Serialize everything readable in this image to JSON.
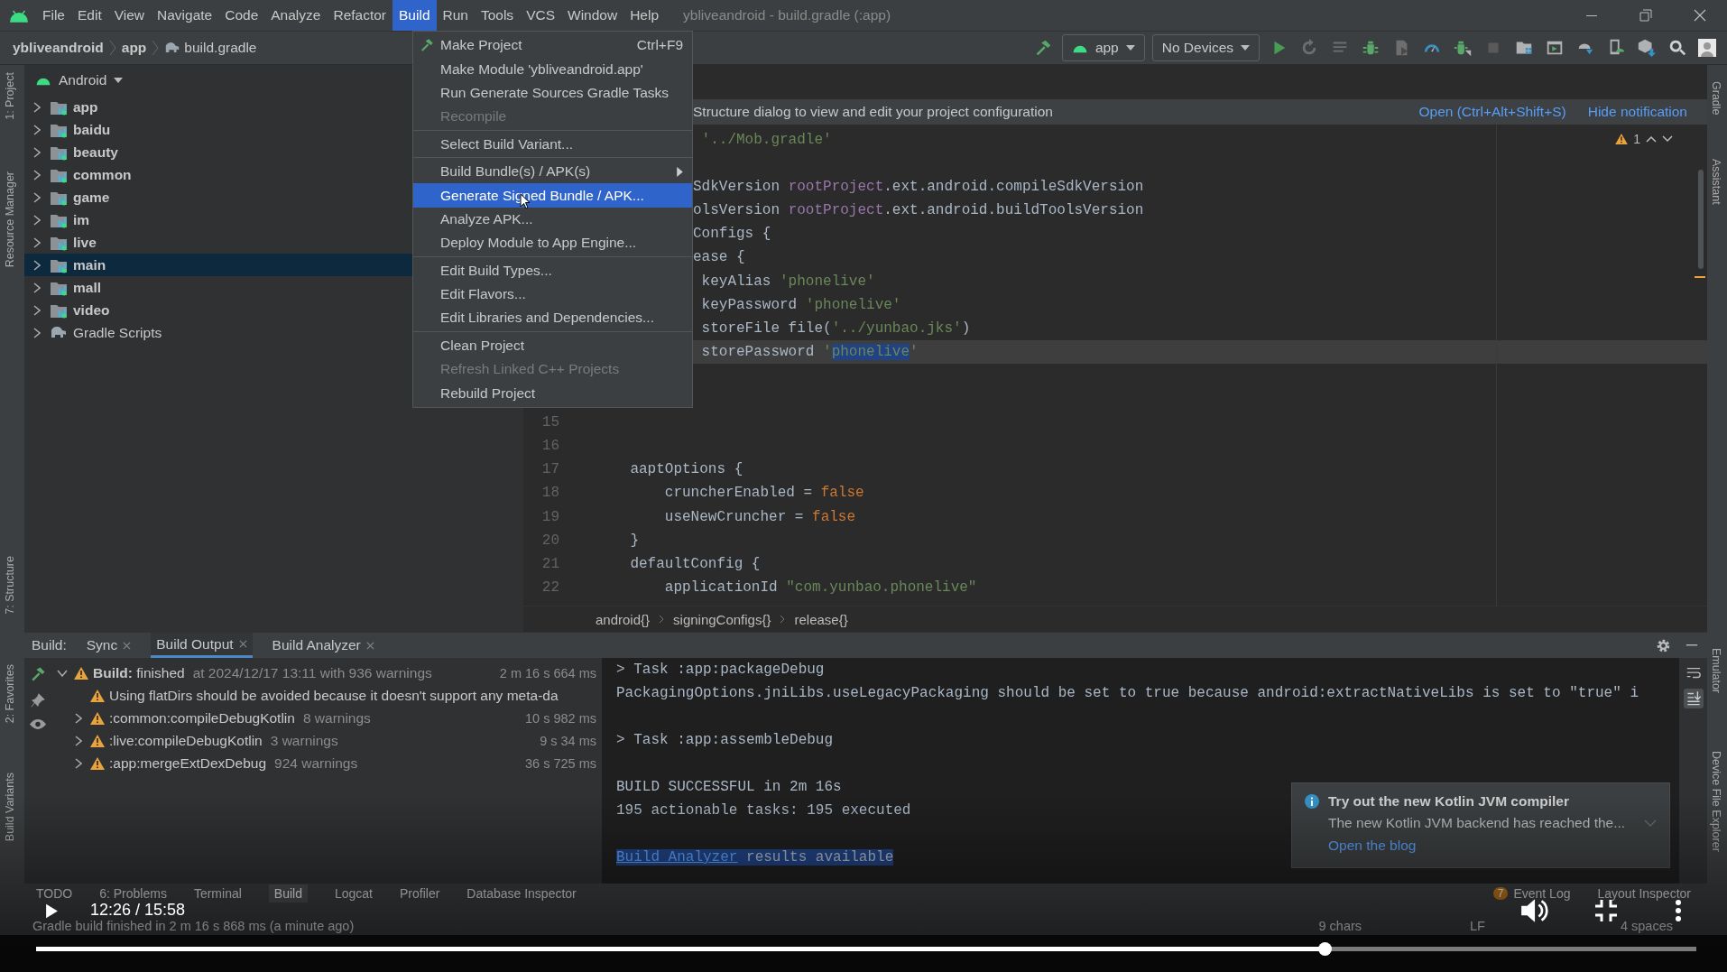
{
  "window": {
    "title": "ybliveandroid - build.gradle (:app)"
  },
  "menu_bar": [
    {
      "label": "File",
      "selected": false
    },
    {
      "label": "Edit",
      "selected": false
    },
    {
      "label": "View",
      "selected": false
    },
    {
      "label": "Navigate",
      "selected": false
    },
    {
      "label": "Code",
      "selected": false
    },
    {
      "label": "Analyze",
      "selected": false
    },
    {
      "label": "Refactor",
      "selected": false
    },
    {
      "label": "Build",
      "selected": true
    },
    {
      "label": "Run",
      "selected": false
    },
    {
      "label": "Tools",
      "selected": false
    },
    {
      "label": "VCS",
      "selected": false
    },
    {
      "label": "Window",
      "selected": false
    },
    {
      "label": "Help",
      "selected": false
    }
  ],
  "breadcrumbs": [
    "ybliveandroid",
    "app",
    "build.gradle"
  ],
  "toolbar": {
    "configuration": "app",
    "device": "No Devices"
  },
  "left_tools": [
    "1: Project",
    "Resource Manager",
    "7: Structure",
    "2: Favorites",
    "Build Variants"
  ],
  "right_tools": [
    "Gradle",
    "Assistant",
    "Emulator",
    "Device File Explorer"
  ],
  "project_panel": {
    "view": "Android",
    "items": [
      {
        "label": "app",
        "kind": "module",
        "selected": false,
        "expanded": false
      },
      {
        "label": "baidu",
        "kind": "module",
        "selected": false,
        "expanded": false
      },
      {
        "label": "beauty",
        "kind": "module",
        "selected": false,
        "expanded": false
      },
      {
        "label": "common",
        "kind": "module",
        "selected": false,
        "expanded": false
      },
      {
        "label": "game",
        "kind": "module",
        "selected": false,
        "expanded": false
      },
      {
        "label": "im",
        "kind": "module",
        "selected": false,
        "expanded": false
      },
      {
        "label": "live",
        "kind": "module",
        "selected": false,
        "expanded": false
      },
      {
        "label": "main",
        "kind": "module",
        "selected": true,
        "expanded": false
      },
      {
        "label": "mall",
        "kind": "module",
        "selected": false,
        "expanded": false
      },
      {
        "label": "video",
        "kind": "module",
        "selected": false,
        "expanded": false
      },
      {
        "label": "Gradle Scripts",
        "kind": "scripts",
        "selected": false,
        "expanded": false
      }
    ]
  },
  "build_menu": {
    "groups": [
      [
        {
          "label": "Make Project",
          "shortcut": "Ctrl+F9",
          "kind": "hammer",
          "disabled": false,
          "selected": false,
          "submenu": false
        },
        {
          "label": "Make Module 'ybliveandroid.app'",
          "disabled": false,
          "selected": false,
          "submenu": false
        },
        {
          "label": "Run Generate Sources Gradle Tasks",
          "disabled": false,
          "selected": false,
          "submenu": false
        },
        {
          "label": "Recompile",
          "disabled": true,
          "selected": false,
          "submenu": false
        }
      ],
      [
        {
          "label": "Select Build Variant...",
          "disabled": false,
          "selected": false,
          "submenu": false
        }
      ],
      [
        {
          "label": "Build Bundle(s) / APK(s)",
          "disabled": false,
          "selected": false,
          "submenu": true
        },
        {
          "label": "Generate Signed Bundle / APK...",
          "disabled": false,
          "selected": true,
          "submenu": false
        },
        {
          "label": "Analyze APK...",
          "disabled": false,
          "selected": false,
          "submenu": false
        },
        {
          "label": "Deploy Module to App Engine...",
          "disabled": false,
          "selected": false,
          "submenu": false
        }
      ],
      [
        {
          "label": "Edit Build Types...",
          "disabled": false,
          "selected": false,
          "submenu": false
        },
        {
          "label": "Edit Flavors...",
          "disabled": false,
          "selected": false,
          "submenu": false
        },
        {
          "label": "Edit Libraries and Dependencies...",
          "disabled": false,
          "selected": false,
          "submenu": false
        }
      ],
      [
        {
          "label": "Clean Project",
          "disabled": false,
          "selected": false,
          "submenu": false
        },
        {
          "label": "Refresh Linked C++ Projects",
          "disabled": true,
          "selected": false,
          "submenu": false
        },
        {
          "label": "Rebuild Project",
          "disabled": false,
          "selected": false,
          "submenu": false
        }
      ]
    ]
  },
  "notification": {
    "text": "Structure dialog to view and edit your project configuration",
    "links": [
      "Open (Ctrl+Alt+Shift+S)",
      "Hide notification"
    ]
  },
  "editor": {
    "warnings": "1",
    "lines": [
      {
        "kind": "cut",
        "current": false,
        "tokens": [
          {
            "text": " '../Mob.gradle'",
            "kind": "str"
          }
        ]
      },
      {
        "kind": "blank",
        "current": false
      },
      {
        "kind": "cut",
        "current": false,
        "tokens": [
          {
            "text": "SdkVersion ",
            "kind": "plain"
          },
          {
            "text": "rootProject",
            "kind": "ref"
          },
          {
            "text": ".ext.android.compileSdkVersion",
            "kind": "plain"
          }
        ]
      },
      {
        "kind": "cut",
        "current": false,
        "tokens": [
          {
            "text": "olsVersion ",
            "kind": "plain"
          },
          {
            "text": "rootProject",
            "kind": "ref"
          },
          {
            "text": ".ext.android.buildToolsVersion",
            "kind": "plain"
          }
        ]
      },
      {
        "kind": "cut",
        "current": false,
        "tokens": [
          {
            "text": "Configs {",
            "kind": "plain"
          }
        ]
      },
      {
        "kind": "cut",
        "current": false,
        "tokens": [
          {
            "text": "ease {",
            "kind": "plain"
          }
        ]
      },
      {
        "kind": "cut",
        "current": false,
        "tokens": [
          {
            "text": " keyAlias ",
            "kind": "plain"
          },
          {
            "text": "'phonelive'",
            "kind": "str"
          }
        ]
      },
      {
        "kind": "cut",
        "current": false,
        "tokens": [
          {
            "text": " keyPassword ",
            "kind": "plain"
          },
          {
            "text": "'phonelive'",
            "kind": "str"
          }
        ]
      },
      {
        "kind": "cut",
        "current": false,
        "tokens": [
          {
            "text": " storeFile file(",
            "kind": "plain"
          },
          {
            "text": "'../yunbao.jks'",
            "kind": "str"
          },
          {
            "text": ")",
            "kind": "plain"
          }
        ]
      },
      {
        "kind": "cut",
        "current": true,
        "tokens": [
          {
            "text": " storePassword ",
            "kind": "plain"
          },
          {
            "text": "'",
            "kind": "str"
          },
          {
            "text": "phonelive",
            "kind": "sel"
          },
          {
            "text": "'",
            "kind": "str"
          }
        ]
      },
      {
        "kind": "blank",
        "current": false
      },
      {
        "kind": "blank",
        "current": false
      },
      {
        "kind": "code",
        "number": "15",
        "current": false
      },
      {
        "kind": "code",
        "number": "16",
        "current": false
      },
      {
        "kind": "code",
        "number": "17",
        "current": false,
        "tokens": [
          {
            "text": "    aaptOptions {",
            "kind": "plain"
          }
        ]
      },
      {
        "kind": "code",
        "number": "18",
        "current": false,
        "tokens": [
          {
            "text": "        cruncherEnabled = ",
            "kind": "plain"
          },
          {
            "text": "false",
            "kind": "kw"
          }
        ]
      },
      {
        "kind": "code",
        "number": "19",
        "current": false,
        "tokens": [
          {
            "text": "        useNewCruncher = ",
            "kind": "plain"
          },
          {
            "text": "false",
            "kind": "kw"
          }
        ]
      },
      {
        "kind": "code",
        "number": "20",
        "current": false,
        "tokens": [
          {
            "text": "    }",
            "kind": "plain"
          }
        ]
      },
      {
        "kind": "code",
        "number": "21",
        "current": false,
        "tokens": [
          {
            "text": "    defaultConfig {",
            "kind": "plain"
          }
        ]
      },
      {
        "kind": "code",
        "number": "22",
        "current": false,
        "tokens": [
          {
            "text": "        applicationId ",
            "kind": "plain"
          },
          {
            "text": "\"com.yunbao.phonelive\"",
            "kind": "str"
          }
        ]
      }
    ],
    "path": [
      "android{}",
      "signingConfigs{}",
      "release{}"
    ]
  },
  "build_panel": {
    "label": "Build:",
    "tabs": [
      {
        "label": "Sync",
        "selected": false
      },
      {
        "label": "Build Output",
        "selected": true
      },
      {
        "label": "Build Analyzer",
        "selected": false
      }
    ],
    "tree": [
      {
        "text": "**Build:** finished",
        "detail": "at 2024/12/17 13:11 with 936 warnings",
        "time": "2 m 16 s 664 ms",
        "expanded": true,
        "children": [
          {
            "text": "Using flatDirs should be avoided because it doesn't support any meta-da"
          },
          {
            "text": ":common:compileDebugKotlin",
            "detail": "8 warnings",
            "time": "10 s 982 ms",
            "expanded": false
          },
          {
            "text": ":live:compileDebugKotlin",
            "detail": "3 warnings",
            "time": "9 s 34 ms",
            "expanded": false
          },
          {
            "text": ":app:mergeExtDexDebug",
            "detail": "924 warnings",
            "time": "36 s 725 ms",
            "expanded": false
          }
        ]
      }
    ],
    "console": [
      {
        "kind": "text",
        "tokens": [
          {
            "text": "> Task :app:packageDebug",
            "kind": "plain"
          }
        ]
      },
      {
        "kind": "text",
        "tokens": [
          {
            "text": "PackagingOptions.jniLibs.useLegacyPackaging should be set to true because android:extractNativeLibs is set to \"true\" i",
            "kind": "plain"
          }
        ]
      },
      {
        "kind": "blank"
      },
      {
        "kind": "text",
        "tokens": [
          {
            "text": "> Task :app:assembleDebug",
            "kind": "plain"
          }
        ]
      },
      {
        "kind": "blank"
      },
      {
        "kind": "text",
        "tokens": [
          {
            "text": "BUILD SUCCESSFUL in 2m 16s",
            "kind": "plain"
          }
        ]
      },
      {
        "kind": "text",
        "tokens": [
          {
            "text": "195 actionable tasks: 195 executed",
            "kind": "plain"
          }
        ]
      },
      {
        "kind": "blank"
      },
      {
        "kind": "selected",
        "tokens": [
          {
            "text": "Build Analyzer",
            "kind": "link"
          },
          {
            "text": " results available",
            "kind": "plain"
          }
        ]
      }
    ]
  },
  "kotlin_notification": {
    "title": "Try out the new Kotlin JVM compiler",
    "text": "The new Kotlin JVM backend has reached the...",
    "link": "Open the blog"
  },
  "tool_tabs": [
    {
      "label": "TODO",
      "selected": false
    },
    {
      "label": "6: Problems",
      "selected": false
    },
    {
      "label": "Terminal",
      "selected": false
    },
    {
      "label": "Build",
      "selected": true
    },
    {
      "label": "Logcat",
      "selected": false
    },
    {
      "label": "Profiler",
      "selected": false
    },
    {
      "label": "Database Inspector",
      "selected": false
    }
  ],
  "right_tool_tabs": [
    {
      "label": "Event Log",
      "badge": "7"
    },
    {
      "label": "Layout Inspector"
    }
  ],
  "status_bar": {
    "message": "Gradle build finished in 2 m 16 s 868 ms (a minute ago)",
    "items": [
      "9 chars",
      "LF",
      "4 spaces"
    ]
  },
  "video_player": {
    "time": "12:26 / 15:58",
    "progress": {
      "level": 0.776
    }
  }
}
